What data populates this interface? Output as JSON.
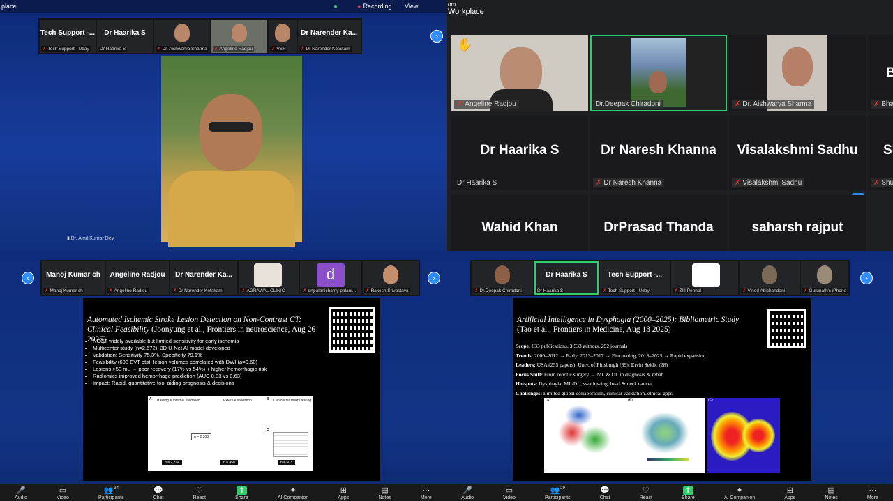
{
  "q1": {
    "title": "place",
    "status": {
      "recording": "Recording",
      "view": "View"
    },
    "strip": [
      {
        "name": "Tech  Support  -...",
        "label": "Tech Support - Uday"
      },
      {
        "name": "Dr Haarika S",
        "label": "Dr Haarika S"
      },
      {
        "name": "",
        "label": "Dr. Aishwarya Sharma"
      },
      {
        "name": "",
        "label": "Angeline Radjou"
      },
      {
        "name": "",
        "label": "VSR"
      },
      {
        "name": "Dr Narender  Ka...",
        "label": "Dr Narender Kotakam"
      }
    ],
    "speaker": "Dr. Amit Kumar Dey"
  },
  "q2": {
    "title": "Workplace",
    "titlePrefix": "om",
    "videoTiles": [
      {
        "label": "Angeline Radjou"
      },
      {
        "label": "Dr.Deepak Chiradoni"
      },
      {
        "label": "Dr. Aishwarya Sharma"
      },
      {
        "label": "Bhav"
      }
    ],
    "nameTiles": [
      {
        "name": "Dr Haarika S",
        "label": "Dr Haarika S"
      },
      {
        "name": "Dr Naresh Khanna",
        "label": "Dr Naresh Khanna"
      },
      {
        "name": "Visalakshmi Sadhu",
        "label": "Visalakshmi Sadhu"
      },
      {
        "name": "Sl",
        "label": "Shul"
      },
      {
        "name": "Wahid Khan",
        "label": ""
      },
      {
        "name": "DrPrasad Thanda",
        "label": ""
      },
      {
        "name": "saharsh rajput",
        "label": ""
      }
    ],
    "more": "···"
  },
  "q3": {
    "strip": [
      {
        "name": "Manoj Kumar ch",
        "label": "Manoj Kumar ch"
      },
      {
        "name": "Angeline Radjou",
        "label": "Angeline Radjou"
      },
      {
        "name": "Dr Narender  Ka...",
        "label": "Dr Narender Kotakam"
      },
      {
        "name": "",
        "label": "AGRAWAL CLINIC"
      },
      {
        "name": "d",
        "label": "drtpalanichamy palani..."
      },
      {
        "name": "",
        "label": "Rakesh Srivastava"
      }
    ],
    "slide": {
      "title": "Automated Ischemic Stroke Lesion Detection on Non-Contrast CT: Clinical Feasibility",
      "cite": "(Joonyung et al., Frontiers in neuroscience, Aug 26 2025)",
      "bullets": [
        "NCCT widely available but limited sensitivity for early ischemia",
        "Multicenter study (n=2,672); 3D U-Net AI model developed",
        "Validation: Sensitivity 75.3%, Specificity 79.1%",
        "Feasibility (603 EVT pts): lesion volumes correlated with DWI (ρ=0.60)",
        "Lesions >50 mL → poor recovery (17% vs 54%) + higher hemorrhagic risk",
        "Radiomics improved hemorrhage prediction (AUC 0.83 vs 0.63)",
        "Impact: Rapid, quantitative tool aiding prognosis & decisions"
      ],
      "figure": {
        "a": "A",
        "b": "B",
        "c": "C",
        "h1": "Training & internal validation",
        "h2": "External validation",
        "h3": "Clinical feasibility testing",
        "n1": "n = 2,308",
        "n2": "n = 2,214",
        "n3": "n = 458",
        "n4": "n = 603"
      }
    },
    "toolbar": [
      {
        "icon": "🎤",
        "label": "Audio"
      },
      {
        "icon": "▭",
        "label": "Video"
      },
      {
        "icon": "👥",
        "label": "Participants",
        "count": "34"
      },
      {
        "icon": "💬",
        "label": "Chat"
      },
      {
        "icon": "♡",
        "label": "React"
      },
      {
        "icon": "⬆",
        "label": "Share"
      },
      {
        "icon": "✦",
        "label": "AI Companion"
      },
      {
        "icon": "⊞",
        "label": "Apps"
      },
      {
        "icon": "▤",
        "label": "Notes"
      },
      {
        "icon": "⋯",
        "label": "More"
      }
    ]
  },
  "q4": {
    "strip": [
      {
        "name": "",
        "label": "Dr.Deepak Chiradoni"
      },
      {
        "name": "Dr Haarika S",
        "label": "Dr Haarika S"
      },
      {
        "name": "Tech  Support  -...",
        "label": "Tech Support - Uday"
      },
      {
        "name": "",
        "label": "ZIII Pennpl"
      },
      {
        "name": "",
        "label": "Vinod Abichandani"
      },
      {
        "name": "",
        "label": "Gurunath's iPhone"
      }
    ],
    "slide": {
      "title": "Artificial Intelligence in Dysphagia (2000–2025): Bibliometric Study",
      "cite": "(Tao et al., Frontiers in Medicine, Aug 18 2025)",
      "lines": [
        {
          "k": "Scope:",
          "v": " 633 publications, 3,533 authors, 292 journals"
        },
        {
          "k": "Trends:",
          "v": " 2000–2012 → Early, 2013–2017 → Fluctuating, 2018–2025 → Rapid expansion"
        },
        {
          "k": "Leaders:",
          "v": " USA (255 papers); Univ. of Pittsburgh (39); Ervin Sejdic (28)"
        },
        {
          "k": "Focus Shift:",
          "v": " From robotic surgery → ML & DL in diagnosis & rehab"
        },
        {
          "k": "Hotspots:",
          "v": " Dysphagia, ML/DL, swallowing, head & neck cancer"
        },
        {
          "k": "Challenges:",
          "v": " Limited global collaboration, clinical validation, ethical gaps"
        }
      ],
      "panels": [
        "(A)",
        "(B)",
        "(C)"
      ]
    },
    "toolbar": [
      {
        "icon": "🎤",
        "label": "Audio"
      },
      {
        "icon": "▭",
        "label": "Video"
      },
      {
        "icon": "👥",
        "label": "Participants",
        "count": "29"
      },
      {
        "icon": "💬",
        "label": "Chat"
      },
      {
        "icon": "♡",
        "label": "React"
      },
      {
        "icon": "⬆",
        "label": "Share"
      },
      {
        "icon": "✦",
        "label": "AI Companion"
      },
      {
        "icon": "⊞",
        "label": "Apps"
      },
      {
        "icon": "▤",
        "label": "Notes"
      },
      {
        "icon": "⋯",
        "label": "More"
      }
    ]
  }
}
